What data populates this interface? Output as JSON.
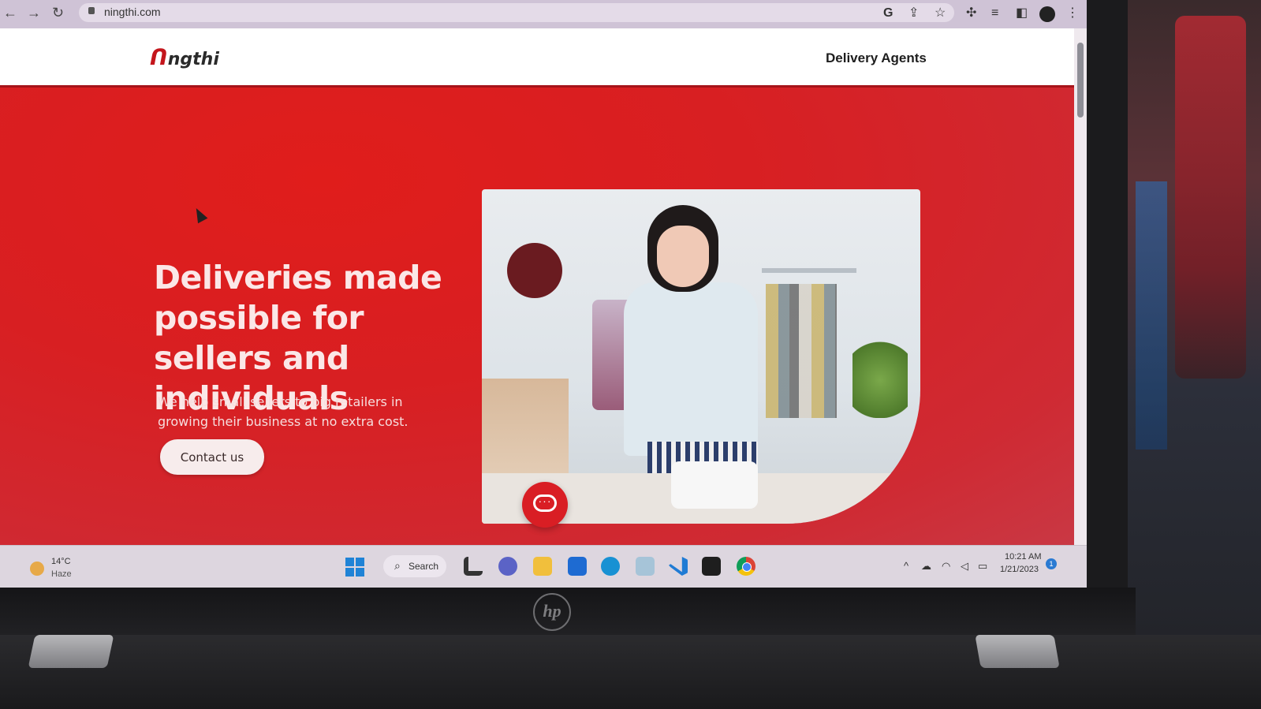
{
  "browser": {
    "url": "ningthi.com"
  },
  "site": {
    "logo_text": "ngthi",
    "logo_mark": "ᑎ",
    "nav": {
      "delivery_agents": "Delivery Agents"
    }
  },
  "hero": {
    "heading": "Deliveries made possible for sellers and individuals",
    "subtext": "We help small sellers to big retailers in growing their business at no extra cost.",
    "cta_label": "Contact us"
  },
  "taskbar": {
    "weather_temp": "14°C",
    "weather_condition": "Haze",
    "search_label": "Search",
    "clock_time": "10:21 AM",
    "clock_date": "1/21/2023",
    "notification_count": "1"
  },
  "device": {
    "logo": "hp"
  },
  "colors": {
    "brand_red": "#d81f22",
    "accent_button_bg": "#f7ecec"
  },
  "icons": [
    "back-icon",
    "forward-icon",
    "reload-icon",
    "lock-icon",
    "google-icon",
    "share-icon",
    "star-icon",
    "extensions-icon",
    "reading-list-icon",
    "side-panel-icon",
    "profile-icon",
    "menu-icon",
    "chat-icon",
    "windows-start-icon",
    "search-icon"
  ]
}
